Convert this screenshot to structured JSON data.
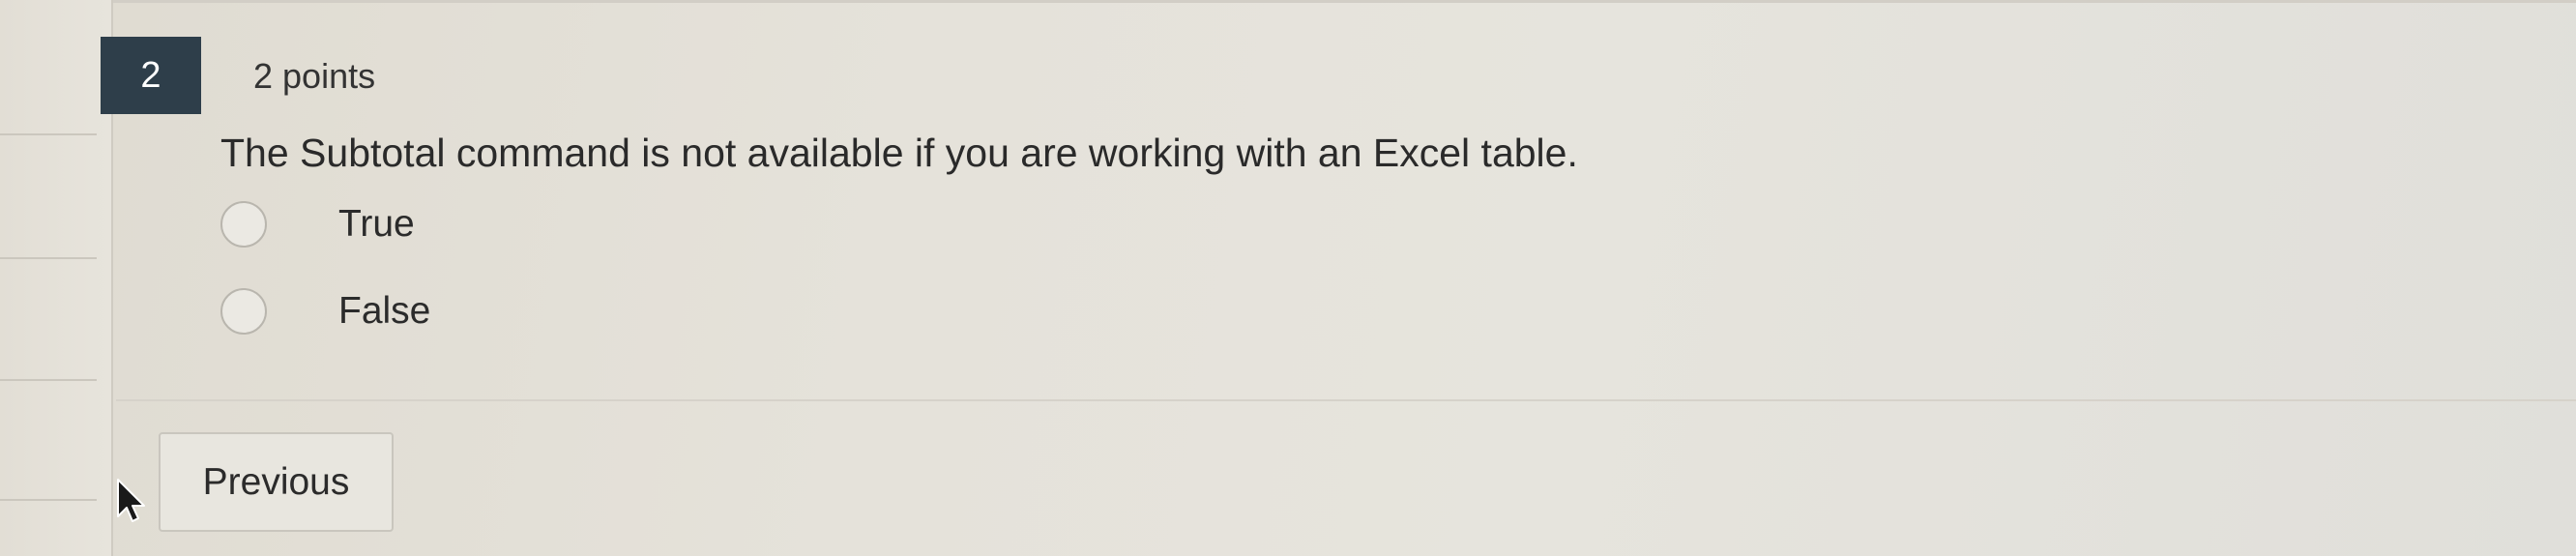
{
  "question": {
    "number": "2",
    "points": "2 points",
    "text": "The Subtotal command is not available if you are working with an Excel table.",
    "options": [
      {
        "label": "True",
        "selected": false
      },
      {
        "label": "False",
        "selected": false
      }
    ]
  },
  "navigation": {
    "previous_label": "Previous"
  },
  "icons": {
    "cursor": "mouse-pointer-icon"
  },
  "colors": {
    "question_number_bg": "#2e3e4a",
    "question_number_text": "#ffffff"
  }
}
